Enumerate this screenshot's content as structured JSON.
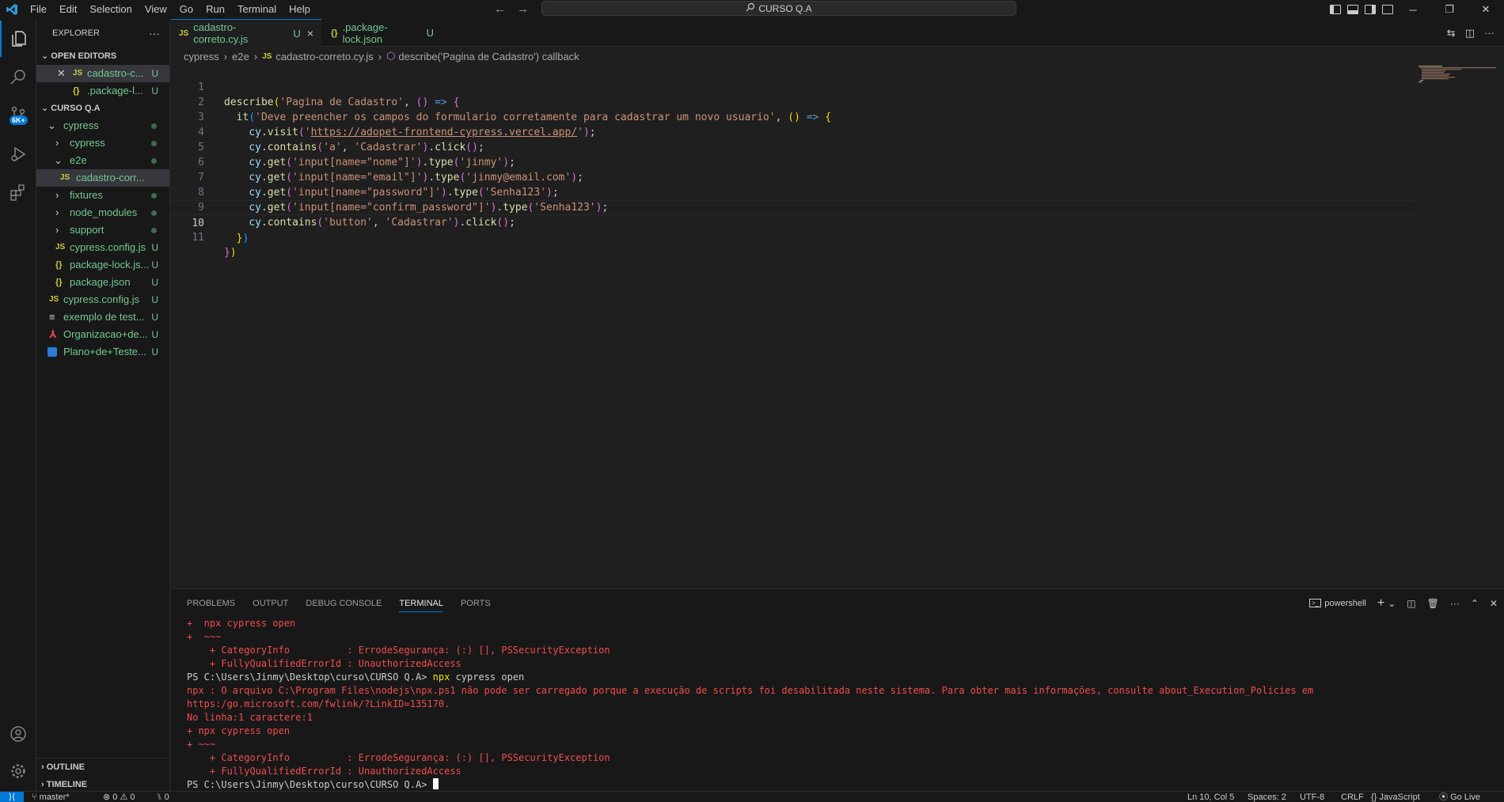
{
  "titlebar": {
    "menu": [
      "File",
      "Edit",
      "Selection",
      "View",
      "Go",
      "Run",
      "Terminal",
      "Help"
    ],
    "command_center": "CURSO Q.A"
  },
  "activity": {
    "source_control_badge": "6K+"
  },
  "sidebar": {
    "title": "EXPLORER",
    "open_editors_label": "OPEN EDITORS",
    "open_editors": [
      {
        "name": "cadastro-c...",
        "status": "U"
      },
      {
        "name": ".package-l...",
        "status": "U"
      }
    ],
    "workspace_label": "CURSO Q.A",
    "tree": [
      {
        "name": "cypress"
      },
      {
        "name": "cypress"
      },
      {
        "name": "e2e"
      },
      {
        "name": "cadastro-corr..."
      },
      {
        "name": "fixtures"
      },
      {
        "name": "node_modules"
      },
      {
        "name": "support"
      },
      {
        "name": "cypress.config.js",
        "status": "U"
      },
      {
        "name": "package-lock.js...",
        "status": "U"
      },
      {
        "name": "package.json",
        "status": "U"
      },
      {
        "name": "cypress.config.js",
        "status": "U"
      },
      {
        "name": "exemplo de test...",
        "status": "U"
      },
      {
        "name": "Organizacao+de...",
        "status": "U"
      },
      {
        "name": "Plano+de+Teste...",
        "status": "U"
      }
    ],
    "outline_label": "OUTLINE",
    "timeline_label": "TIMELINE"
  },
  "tabs": [
    {
      "label": "cadastro-correto.cy.js",
      "status": "U",
      "close": "×"
    },
    {
      "label": ".package-lock.json",
      "status": "U"
    }
  ],
  "breadcrumbs": [
    "cypress",
    "e2e",
    "cadastro-correto.cy.js",
    "describe('Pagina de Cadastro') callback"
  ],
  "code": {
    "line_numbers": [
      "1",
      "2",
      "3",
      "4",
      "5",
      "6",
      "7",
      "8",
      "9",
      "10",
      "11"
    ],
    "current_line": 10
  },
  "panel": {
    "tabs": [
      "PROBLEMS",
      "OUTPUT",
      "DEBUG CONSOLE",
      "TERMINAL",
      "PORTS"
    ],
    "active_tab": "TERMINAL",
    "shell": "powershell",
    "terminal_lines": [
      "+  npx cypress open",
      "+  ~~~",
      "    + CategoryInfo          : ErrodeSegurança: (:) [], PSSecurityException",
      "    + FullyQualifiedErrorId : UnauthorizedAccess",
      "npx : O arquivo C:\\Program Files\\nodejs\\npx.ps1 não pode ser carregado porque a execução de scripts foi desabilitada neste sistema. Para obter mais informações, consulte about_Execution_Policies em",
      "https:/go.microsoft.com/fwlink/?LinkID=135170.",
      "No linha:1 caractere:1",
      "+ npx cypress open",
      "+ ~~~",
      "    + CategoryInfo          : ErrodeSegurança: (:) [], PSSecurityException",
      "    + FullyQualifiedErrorId : UnauthorizedAccess"
    ],
    "prompt": "PS C:\\Users\\Jinmy\\Desktop\\curso\\CURSO Q.A> ",
    "cmd_npx": "npx",
    "cmd_rest": " cypress open"
  },
  "statusbar": {
    "branch": "master*",
    "errors": "⊗ 0 ⚠ 0",
    "ports": "⑊ 0",
    "position": "Ln 10, Col 5",
    "spaces": "Spaces: 2",
    "encoding": "UTF-8",
    "eol": "CRLF",
    "language": "{} JavaScript",
    "golive": "Go Live"
  },
  "colors": {
    "accent": "#0078d4",
    "error": "#f14c4c",
    "background": "#1f1f1f"
  }
}
